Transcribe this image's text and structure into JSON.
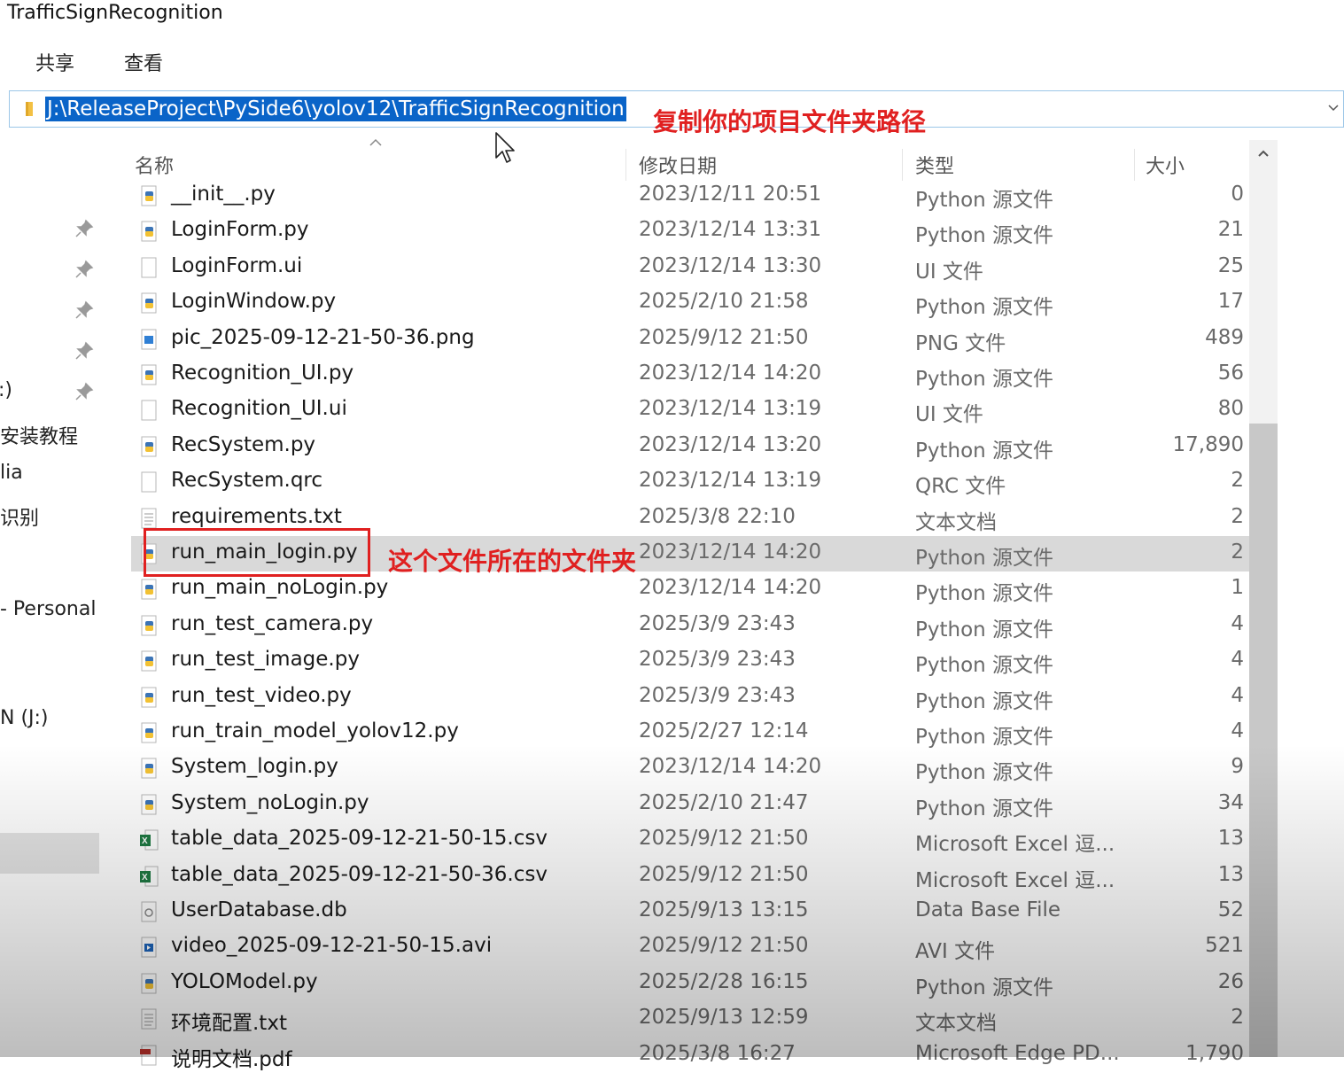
{
  "window": {
    "title": "TrafficSignRecognition"
  },
  "ribbon": {
    "tabs": [
      "共享",
      "查看"
    ]
  },
  "address_bar": {
    "path": "J:\\ReleaseProject\\PySide6\\yolov12\\TrafficSignRecognition"
  },
  "annotations": {
    "path_note": "复制你的项目文件夹路径",
    "file_note": "这个文件所在的文件夹"
  },
  "nav_pane": {
    "items": [
      ":)",
      "安装教程",
      "lia",
      "识别",
      "- Personal",
      "N (J:)",
      ")",
      ")"
    ],
    "selected": "N (J:)"
  },
  "columns": {
    "name": "名称",
    "date": "修改日期",
    "type": "类型",
    "size": "大小"
  },
  "icons": [
    "python-file-icon",
    "text-file-icon",
    "blank-file-icon",
    "image-file-icon",
    "excel-file-icon",
    "database-file-icon",
    "video-file-icon",
    "pdf-file-icon",
    "pin-icon",
    "folder-icon",
    "cursor-icon"
  ],
  "files": [
    {
      "name": "__init__.py",
      "date": "2023/12/11 20:51",
      "type": "Python 源文件",
      "size": "0",
      "icon": "python"
    },
    {
      "name": "LoginForm.py",
      "date": "2023/12/14 13:31",
      "type": "Python 源文件",
      "size": "21",
      "icon": "python"
    },
    {
      "name": "LoginForm.ui",
      "date": "2023/12/14 13:30",
      "type": "UI 文件",
      "size": "25",
      "icon": "blank"
    },
    {
      "name": "LoginWindow.py",
      "date": "2025/2/10 21:58",
      "type": "Python 源文件",
      "size": "17",
      "icon": "python"
    },
    {
      "name": "pic_2025-09-12-21-50-36.png",
      "date": "2025/9/12 21:50",
      "type": "PNG 文件",
      "size": "489",
      "icon": "image"
    },
    {
      "name": "Recognition_UI.py",
      "date": "2023/12/14 14:20",
      "type": "Python 源文件",
      "size": "56",
      "icon": "python"
    },
    {
      "name": "Recognition_UI.ui",
      "date": "2023/12/14 13:19",
      "type": "UI 文件",
      "size": "80",
      "icon": "blank"
    },
    {
      "name": "RecSystem.py",
      "date": "2023/12/14 13:20",
      "type": "Python 源文件",
      "size": "17,890",
      "icon": "python"
    },
    {
      "name": "RecSystem.qrc",
      "date": "2023/12/14 13:19",
      "type": "QRC 文件",
      "size": "2",
      "icon": "blank"
    },
    {
      "name": "requirements.txt",
      "date": "2025/3/8 22:10",
      "type": "文本文档",
      "size": "2",
      "icon": "text"
    },
    {
      "name": "run_main_login.py",
      "date": "2023/12/14 14:20",
      "type": "Python 源文件",
      "size": "2",
      "icon": "python",
      "selected": true
    },
    {
      "name": "run_main_noLogin.py",
      "date": "2023/12/14 14:20",
      "type": "Python 源文件",
      "size": "1",
      "icon": "python"
    },
    {
      "name": "run_test_camera.py",
      "date": "2025/3/9 23:43",
      "type": "Python 源文件",
      "size": "4",
      "icon": "python"
    },
    {
      "name": "run_test_image.py",
      "date": "2025/3/9 23:43",
      "type": "Python 源文件",
      "size": "4",
      "icon": "python"
    },
    {
      "name": "run_test_video.py",
      "date": "2025/3/9 23:43",
      "type": "Python 源文件",
      "size": "4",
      "icon": "python"
    },
    {
      "name": "run_train_model_yolov12.py",
      "date": "2025/2/27 12:14",
      "type": "Python 源文件",
      "size": "4",
      "icon": "python"
    },
    {
      "name": "System_login.py",
      "date": "2023/12/14 14:20",
      "type": "Python 源文件",
      "size": "9",
      "icon": "python"
    },
    {
      "name": "System_noLogin.py",
      "date": "2025/2/10 21:47",
      "type": "Python 源文件",
      "size": "34",
      "icon": "python"
    },
    {
      "name": "table_data_2025-09-12-21-50-15.csv",
      "date": "2025/9/12 21:50",
      "type": "Microsoft Excel 逗...",
      "size": "13",
      "icon": "excel"
    },
    {
      "name": "table_data_2025-09-12-21-50-36.csv",
      "date": "2025/9/12 21:50",
      "type": "Microsoft Excel 逗...",
      "size": "13",
      "icon": "excel"
    },
    {
      "name": "UserDatabase.db",
      "date": "2025/9/13 13:15",
      "type": "Data Base File",
      "size": "52",
      "icon": "database"
    },
    {
      "name": "video_2025-09-12-21-50-15.avi",
      "date": "2025/9/12 21:50",
      "type": "AVI 文件",
      "size": "521",
      "icon": "video"
    },
    {
      "name": "YOLOModel.py",
      "date": "2025/2/28 16:15",
      "type": "Python 源文件",
      "size": "26",
      "icon": "python"
    },
    {
      "name": "环境配置.txt",
      "date": "2025/9/13 12:59",
      "type": "文本文档",
      "size": "2",
      "icon": "text"
    },
    {
      "name": "说明文档.pdf",
      "date": "2025/3/8 16:27",
      "type": "Microsoft Edge PD...",
      "size": "1,790",
      "icon": "pdf"
    }
  ]
}
